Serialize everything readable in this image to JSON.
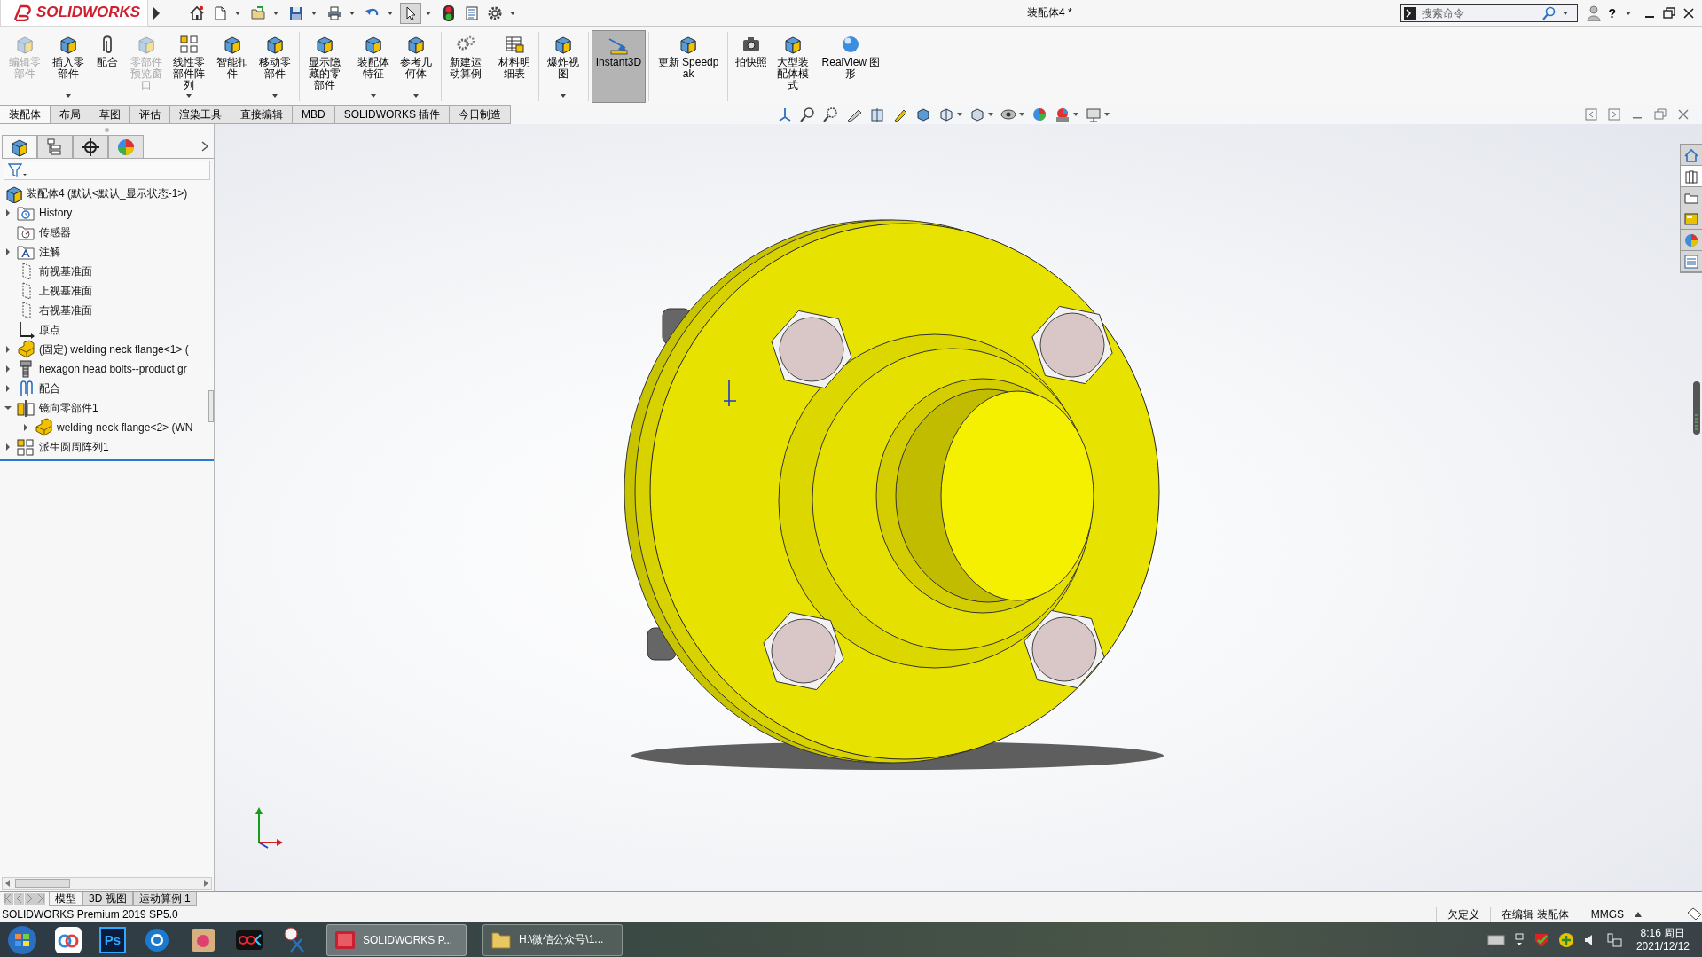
{
  "app": {
    "brand": "SOLIDWORKS",
    "title": "装配体4 *",
    "help": "?"
  },
  "quick_access": [
    {
      "kind": "home",
      "dropdown": false,
      "selected": false
    },
    {
      "kind": "new",
      "dropdown": true,
      "selected": false
    },
    {
      "kind": "open",
      "dropdown": true,
      "selected": false
    },
    {
      "kind": "save",
      "dropdown": true,
      "selected": false
    },
    {
      "kind": "print",
      "dropdown": true,
      "selected": false
    },
    {
      "kind": "undo",
      "dropdown": true,
      "selected": false
    },
    {
      "kind": "select",
      "dropdown": true,
      "selected": true
    },
    {
      "kind": "rebuild",
      "dropdown": false,
      "selected": false
    },
    {
      "kind": "properties",
      "dropdown": false,
      "selected": false
    },
    {
      "kind": "options",
      "dropdown": true,
      "selected": false
    }
  ],
  "search": {
    "placeholder": "搜索命令"
  },
  "ribbon": [
    {
      "kind": "edit",
      "label": "编辑零部件",
      "disabled": true,
      "dropdown": false,
      "selected": false
    },
    {
      "kind": "insert",
      "label": "插入零部件",
      "disabled": false,
      "dropdown": true,
      "selected": false
    },
    {
      "kind": "mate",
      "label": "配合",
      "disabled": false,
      "dropdown": false,
      "selected": false
    },
    {
      "kind": "preview",
      "label": "零部件预览窗口",
      "disabled": true,
      "dropdown": false,
      "selected": false
    },
    {
      "kind": "pattern",
      "label": "线性零部件阵列",
      "disabled": false,
      "dropdown": true,
      "selected": false
    },
    {
      "kind": "fastener",
      "label": "智能扣件",
      "disabled": false,
      "dropdown": false,
      "selected": false
    },
    {
      "kind": "move",
      "label": "移动零部件",
      "disabled": false,
      "dropdown": true,
      "selected": false
    },
    {
      "kind": "show",
      "label": "显示隐藏的零部件",
      "disabled": false,
      "dropdown": false,
      "selected": false
    },
    {
      "kind": "feature",
      "label": "装配体特征",
      "disabled": false,
      "dropdown": true,
      "selected": false
    },
    {
      "kind": "reference",
      "label": "参考几何体",
      "disabled": false,
      "dropdown": true,
      "selected": false
    },
    {
      "kind": "motion",
      "label": "新建运动算例",
      "disabled": false,
      "dropdown": false,
      "selected": false
    },
    {
      "kind": "bom",
      "label": "材料明细表",
      "disabled": false,
      "dropdown": false,
      "selected": false
    },
    {
      "kind": "explode",
      "label": "爆炸视图",
      "disabled": false,
      "dropdown": true,
      "selected": false
    },
    {
      "kind": "instant3d",
      "label": "Instant3D",
      "disabled": false,
      "dropdown": false,
      "selected": true
    },
    {
      "kind": "speedpak",
      "label": "更新 Speedpak",
      "disabled": false,
      "dropdown": false,
      "selected": false
    },
    {
      "kind": "snapshot",
      "label": "拍快照",
      "disabled": false,
      "dropdown": false,
      "selected": false
    },
    {
      "kind": "large",
      "label": "大型装配体模式",
      "disabled": false,
      "dropdown": false,
      "selected": false
    },
    {
      "kind": "realview",
      "label": "RealView 图形",
      "disabled": false,
      "dropdown": false,
      "selected": false
    }
  ],
  "tabs": [
    {
      "label": "装配体",
      "selected": true
    },
    {
      "label": "布局",
      "selected": false
    },
    {
      "label": "草图",
      "selected": false
    },
    {
      "label": "评估",
      "selected": false
    },
    {
      "label": "渲染工具",
      "selected": false
    },
    {
      "label": "直接编辑",
      "selected": false
    },
    {
      "label": "MBD",
      "selected": false
    },
    {
      "label": "SOLIDWORKS 插件",
      "selected": false
    },
    {
      "label": "今日制造",
      "selected": false
    }
  ],
  "panel_tabs": [
    {
      "kind": "tree",
      "selected": true
    },
    {
      "kind": "property",
      "selected": false
    },
    {
      "kind": "config",
      "selected": false
    },
    {
      "kind": "display",
      "selected": false
    }
  ],
  "tree": {
    "root": {
      "kind": "assembly",
      "label": "装配体4  (默认<默认_显示状态-1>)"
    },
    "items": [
      {
        "kind": "history",
        "label": "History",
        "expandable": true,
        "expanded": false
      },
      {
        "kind": "sensor",
        "label": "传感器",
        "expandable": false
      },
      {
        "kind": "annotation",
        "label": "注解",
        "expandable": true,
        "expanded": false
      },
      {
        "kind": "plane",
        "label": "前视基准面",
        "expandable": false
      },
      {
        "kind": "plane",
        "label": "上视基准面",
        "expandable": false
      },
      {
        "kind": "plane",
        "label": "右视基准面",
        "expandable": false
      },
      {
        "kind": "origin",
        "label": "原点",
        "expandable": false
      },
      {
        "kind": "part",
        "label": "(固定) welding neck flange<1> (",
        "expandable": true,
        "expanded": false
      },
      {
        "kind": "bolt",
        "label": "hexagon head bolts--product gr",
        "expandable": true,
        "expanded": false
      },
      {
        "kind": "mate",
        "label": "配合",
        "expandable": true,
        "expanded": false
      },
      {
        "kind": "mirror",
        "label": "镜向零部件1",
        "expandable": true,
        "expanded": true,
        "children": [
          {
            "kind": "part",
            "label": "welding neck flange<2> (WN",
            "expandable": true,
            "expanded": false
          }
        ]
      },
      {
        "kind": "pattern",
        "label": "派生圆周阵列1",
        "expandable": true,
        "expanded": false
      }
    ]
  },
  "task_pane_tabs": [
    {
      "kind": "home",
      "selected": false
    },
    {
      "kind": "library",
      "selected": true
    },
    {
      "kind": "folder",
      "selected": false
    },
    {
      "kind": "palette",
      "selected": false
    },
    {
      "kind": "appearance",
      "selected": false
    },
    {
      "kind": "properties",
      "selected": false
    }
  ],
  "bottom_tabs": [
    {
      "label": "模型",
      "selected": true
    },
    {
      "label": "3D 视图",
      "selected": false
    },
    {
      "label": "运动算例 1",
      "selected": false
    }
  ],
  "status_bar": {
    "version": "SOLIDWORKS Premium 2019 SP5.0",
    "items": [
      "欠定义",
      "在编辑 装配体",
      "MMGS"
    ]
  },
  "taskbar": {
    "pinned": [
      {
        "kind": "cloud"
      },
      {
        "kind": "ps",
        "label": "Ps"
      },
      {
        "kind": "browser"
      },
      {
        "kind": "photos"
      },
      {
        "kind": "recorder"
      },
      {
        "kind": "scissors"
      }
    ],
    "tasks": [
      {
        "kind": "solidworks",
        "label": "SOLIDWORKS P...",
        "selected": true
      },
      {
        "kind": "folder",
        "label": "H:\\微信公众号\\1...",
        "selected": false
      }
    ],
    "clock": {
      "time": "8:16 周日",
      "date": "2021/12/12"
    }
  }
}
